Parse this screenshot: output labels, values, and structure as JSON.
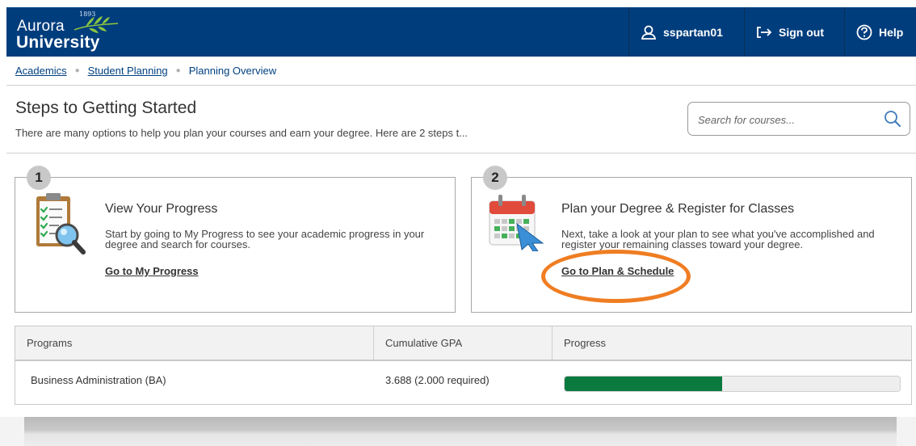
{
  "header": {
    "logo_year": "1893",
    "logo_line1": "Aurora",
    "logo_line2": "University",
    "username": "sspartan01",
    "signout_label": "Sign out",
    "help_label": "Help",
    "background_color": "#003d7d"
  },
  "breadcrumb": {
    "items": [
      "Academics",
      "Student Planning",
      "Planning Overview"
    ]
  },
  "page": {
    "title": "Steps to Getting Started",
    "subtitle": "There are many options to help you plan your courses and earn your degree. Here are 2 steps t..."
  },
  "search": {
    "placeholder": "Search for courses..."
  },
  "steps": [
    {
      "number": "1",
      "icon": "clipboard-magnifier-icon",
      "title": "View Your Progress",
      "description": "Start by going to My Progress to see your academic progress in your degree and search for courses.",
      "link": "Go to My Progress"
    },
    {
      "number": "2",
      "icon": "calendar-cursor-icon",
      "title": "Plan your Degree & Register for Classes",
      "description": "Next, take a look at your plan to see what you've accomplished and register your remaining classes toward your degree.",
      "link": "Go to Plan & Schedule"
    }
  ],
  "programs_table": {
    "headers": [
      "Programs",
      "Cumulative GPA",
      "Progress"
    ],
    "rows": [
      {
        "program": "Business Administration (BA)",
        "gpa": "3.688 (2.000 required)",
        "progress_fraction": 0.47
      }
    ]
  },
  "colors": {
    "highlight_ring": "#ef7d22",
    "progress_fill": "#0b7a3e"
  }
}
